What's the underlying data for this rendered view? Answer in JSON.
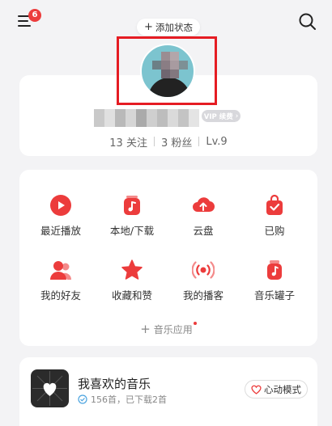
{
  "header": {
    "menu_badge": "6",
    "add_status_label": "添加状态"
  },
  "profile": {
    "vip_label": "VIP 续费",
    "stats": {
      "follows": "13 关注",
      "fans": "3 粉丝",
      "level": "Lv.9"
    }
  },
  "apps": {
    "items": [
      {
        "label": "最近播放",
        "icon": "play-circle-icon"
      },
      {
        "label": "本地/下载",
        "icon": "music-download-icon"
      },
      {
        "label": "云盘",
        "icon": "cloud-upload-icon"
      },
      {
        "label": "已购",
        "icon": "shopping-bag-icon"
      },
      {
        "label": "我的好友",
        "icon": "friends-icon"
      },
      {
        "label": "收藏和赞",
        "icon": "star-icon"
      },
      {
        "label": "我的播客",
        "icon": "podcast-icon"
      },
      {
        "label": "音乐罐子",
        "icon": "music-jar-icon"
      }
    ],
    "more_label": "音乐应用"
  },
  "favorites": {
    "title": "我喜欢的音乐",
    "subtitle": "156首，已下载2首",
    "mode_label": "心动模式"
  },
  "colors": {
    "accent": "#ec3c3c",
    "highlight_box": "#e51c23"
  }
}
